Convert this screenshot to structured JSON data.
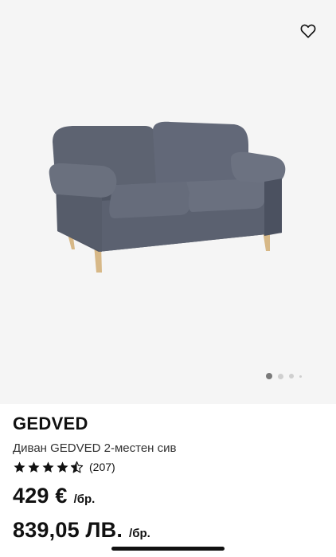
{
  "gallery": {
    "favorite_icon": "heart-outline-icon",
    "image_alt": "Диван GEDVED 2-местен сив",
    "page_count": 4,
    "active_page": 1
  },
  "product": {
    "brand": "GEDVED",
    "description": "Диван GEDVED 2-местен сив",
    "rating": 4.5,
    "review_count": "(207)",
    "price_eur": "429 €",
    "price_eur_unit": "/бр.",
    "price_bgn": "839,05 ЛВ.",
    "price_bgn_unit": "/бр."
  },
  "colors": {
    "gallery_bg": "#f5f5f5",
    "sofa": "#5c6270",
    "star": "#111111"
  }
}
